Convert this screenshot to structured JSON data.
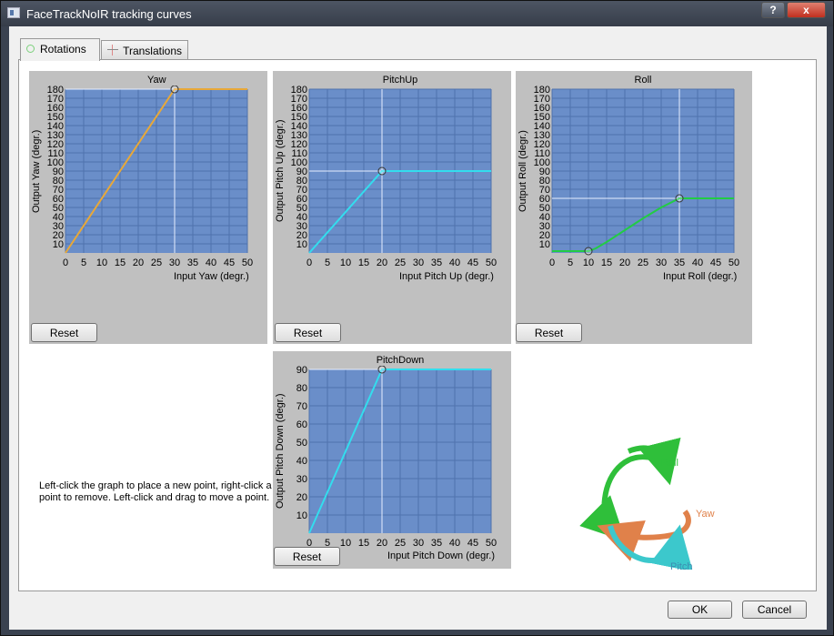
{
  "window": {
    "title": "FaceTrackNoIR tracking curves",
    "help_label": "?",
    "close_label": "x"
  },
  "tabs": [
    {
      "label": "Rotations",
      "active": true
    },
    {
      "label": "Translations",
      "active": false
    }
  ],
  "reset_label": "Reset",
  "help_text": "Left-click the graph to place a new point, right-click a point to remove. Left-click and drag to move a point.",
  "diagram_labels": {
    "roll": "Roll",
    "yaw": "Yaw",
    "pitch": "Pitch"
  },
  "buttons": {
    "ok": "OK",
    "cancel": "Cancel"
  },
  "colors": {
    "plot_bg": "#6a8ec9",
    "grid": "#4f72ad",
    "panel_bg": "#c0c0c0"
  },
  "chart_data": [
    {
      "type": "line",
      "title": "Yaw",
      "xlabel": "Input Yaw (degr.)",
      "ylabel": "Output Yaw (degr.)",
      "xlim": [
        0,
        50
      ],
      "ylim": [
        0,
        180
      ],
      "x_ticks": [
        0,
        5,
        10,
        15,
        20,
        25,
        30,
        35,
        40,
        45,
        50
      ],
      "y_ticks": [
        10,
        20,
        30,
        40,
        50,
        60,
        70,
        80,
        90,
        100,
        110,
        120,
        130,
        140,
        150,
        160,
        170,
        180
      ],
      "x_tick_labels": [
        "0",
        "5",
        "10",
        "15",
        "20",
        "25",
        "30",
        "35",
        "40",
        "45",
        "50"
      ],
      "y_tick_labels": [
        "10",
        "20",
        "30",
        "40",
        "50",
        "60",
        "70",
        "80",
        "90",
        "100",
        "110",
        "120",
        "130",
        "140",
        "150",
        "160",
        "170",
        "180"
      ],
      "color": "#e8a838",
      "points": [
        [
          0,
          0
        ],
        [
          30,
          180
        ],
        [
          50,
          180
        ]
      ],
      "control_points": [
        [
          30,
          180
        ]
      ]
    },
    {
      "type": "line",
      "title": "PitchUp",
      "xlabel": "Input Pitch Up (degr.)",
      "ylabel": "Output Pitch Up (degr.)",
      "xlim": [
        0,
        50
      ],
      "ylim": [
        0,
        180
      ],
      "x_ticks": [
        0,
        5,
        10,
        15,
        20,
        25,
        30,
        35,
        40,
        45,
        50
      ],
      "y_ticks": [
        10,
        20,
        30,
        40,
        50,
        60,
        70,
        80,
        90,
        100,
        110,
        120,
        130,
        140,
        150,
        160,
        170,
        180
      ],
      "x_tick_labels": [
        "0",
        "5",
        "10",
        "15",
        "20",
        "25",
        "30",
        "35",
        "40",
        "45",
        "50"
      ],
      "y_tick_labels": [
        "10",
        "20",
        "30",
        "40",
        "50",
        "60",
        "70",
        "80",
        "90",
        "100",
        "110",
        "120",
        "130",
        "140",
        "150",
        "160",
        "170",
        "180"
      ],
      "color": "#33ddee",
      "points": [
        [
          0,
          0
        ],
        [
          20,
          90
        ],
        [
          50,
          90
        ]
      ],
      "control_points": [
        [
          20,
          90
        ]
      ]
    },
    {
      "type": "line",
      "title": "Roll",
      "xlabel": "Input Roll (degr.)",
      "ylabel": "Output Roll (degr.)",
      "xlim": [
        0,
        50
      ],
      "ylim": [
        0,
        180
      ],
      "x_ticks": [
        0,
        5,
        10,
        15,
        20,
        25,
        30,
        35,
        40,
        45,
        50
      ],
      "y_ticks": [
        10,
        20,
        30,
        40,
        50,
        60,
        70,
        80,
        90,
        100,
        110,
        120,
        130,
        140,
        150,
        160,
        170,
        180
      ],
      "x_tick_labels": [
        "0",
        "5",
        "10",
        "15",
        "20",
        "25",
        "30",
        "35",
        "40",
        "45",
        "50"
      ],
      "y_tick_labels": [
        "10",
        "20",
        "30",
        "40",
        "50",
        "60",
        "70",
        "80",
        "90",
        "100",
        "110",
        "120",
        "130",
        "140",
        "150",
        "160",
        "170",
        "180"
      ],
      "color": "#22cc44",
      "points": [
        [
          0,
          2
        ],
        [
          10,
          2
        ],
        [
          12,
          5
        ],
        [
          15,
          12
        ],
        [
          20,
          25
        ],
        [
          25,
          38
        ],
        [
          30,
          50
        ],
        [
          35,
          60
        ],
        [
          50,
          60
        ]
      ],
      "control_points": [
        [
          10,
          2
        ],
        [
          35,
          60
        ]
      ]
    },
    {
      "type": "line",
      "title": "PitchDown",
      "xlabel": "Input Pitch Down (degr.)",
      "ylabel": "Output Pitch Down (degr.)",
      "xlim": [
        0,
        50
      ],
      "ylim": [
        0,
        90
      ],
      "x_ticks": [
        0,
        5,
        10,
        15,
        20,
        25,
        30,
        35,
        40,
        45,
        50
      ],
      "y_ticks": [
        10,
        20,
        30,
        40,
        50,
        60,
        70,
        80,
        90
      ],
      "x_tick_labels": [
        "0",
        "5",
        "10",
        "15",
        "20",
        "25",
        "30",
        "35",
        "40",
        "45",
        "50"
      ],
      "y_tick_labels": [
        "10",
        "20",
        "30",
        "40",
        "50",
        "60",
        "70",
        "80",
        "90"
      ],
      "color": "#33ddee",
      "points": [
        [
          0,
          0
        ],
        [
          20,
          90
        ],
        [
          50,
          90
        ]
      ],
      "control_points": [
        [
          20,
          90
        ]
      ]
    }
  ]
}
